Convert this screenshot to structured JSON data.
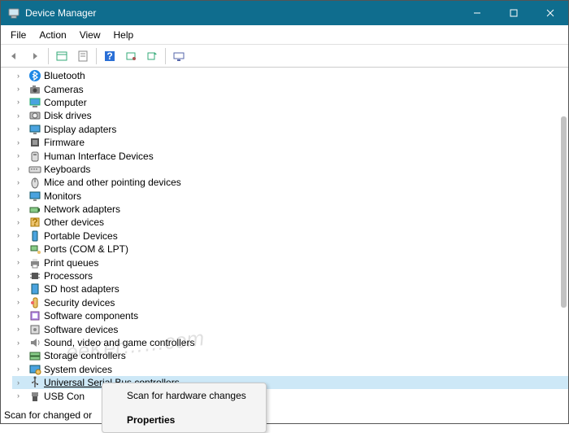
{
  "window": {
    "title": "Device Manager"
  },
  "menus": [
    "File",
    "Action",
    "View",
    "Help"
  ],
  "toolbar_icons": [
    "back-icon",
    "forward-icon",
    "sep",
    "show-hide-tree-icon",
    "properties-icon",
    "sep",
    "help-icon",
    "action-icon",
    "scan-icon",
    "sep",
    "show-devices-icon"
  ],
  "tree": [
    {
      "label": "Bluetooth",
      "icon": "bluetooth"
    },
    {
      "label": "Cameras",
      "icon": "camera"
    },
    {
      "label": "Computer",
      "icon": "computer"
    },
    {
      "label": "Disk drives",
      "icon": "disk"
    },
    {
      "label": "Display adapters",
      "icon": "display"
    },
    {
      "label": "Firmware",
      "icon": "firmware"
    },
    {
      "label": "Human Interface Devices",
      "icon": "hid"
    },
    {
      "label": "Keyboards",
      "icon": "keyboard"
    },
    {
      "label": "Mice and other pointing devices",
      "icon": "mouse"
    },
    {
      "label": "Monitors",
      "icon": "monitor"
    },
    {
      "label": "Network adapters",
      "icon": "network"
    },
    {
      "label": "Other devices",
      "icon": "other"
    },
    {
      "label": "Portable Devices",
      "icon": "portable"
    },
    {
      "label": "Ports (COM & LPT)",
      "icon": "ports"
    },
    {
      "label": "Print queues",
      "icon": "printer"
    },
    {
      "label": "Processors",
      "icon": "cpu"
    },
    {
      "label": "SD host adapters",
      "icon": "sd"
    },
    {
      "label": "Security devices",
      "icon": "security"
    },
    {
      "label": "Software components",
      "icon": "swcomp"
    },
    {
      "label": "Software devices",
      "icon": "swdev"
    },
    {
      "label": "Sound, video and game controllers",
      "icon": "sound"
    },
    {
      "label": "Storage controllers",
      "icon": "storage"
    },
    {
      "label": "System devices",
      "icon": "system"
    },
    {
      "label": "Universal Serial Bus controllers",
      "icon": "usb",
      "selected": true
    },
    {
      "label": "USB Con",
      "icon": "usbconn"
    }
  ],
  "context_menu": {
    "items": [
      {
        "label": "Scan for hardware changes",
        "bold": false
      },
      {
        "label": "Properties",
        "bold": true
      }
    ]
  },
  "statusbar": "Scan for changed or",
  "watermark": "eeKer……com",
  "colors": {
    "titlebar": "#0f6d8e",
    "selection": "#cde8f7"
  }
}
